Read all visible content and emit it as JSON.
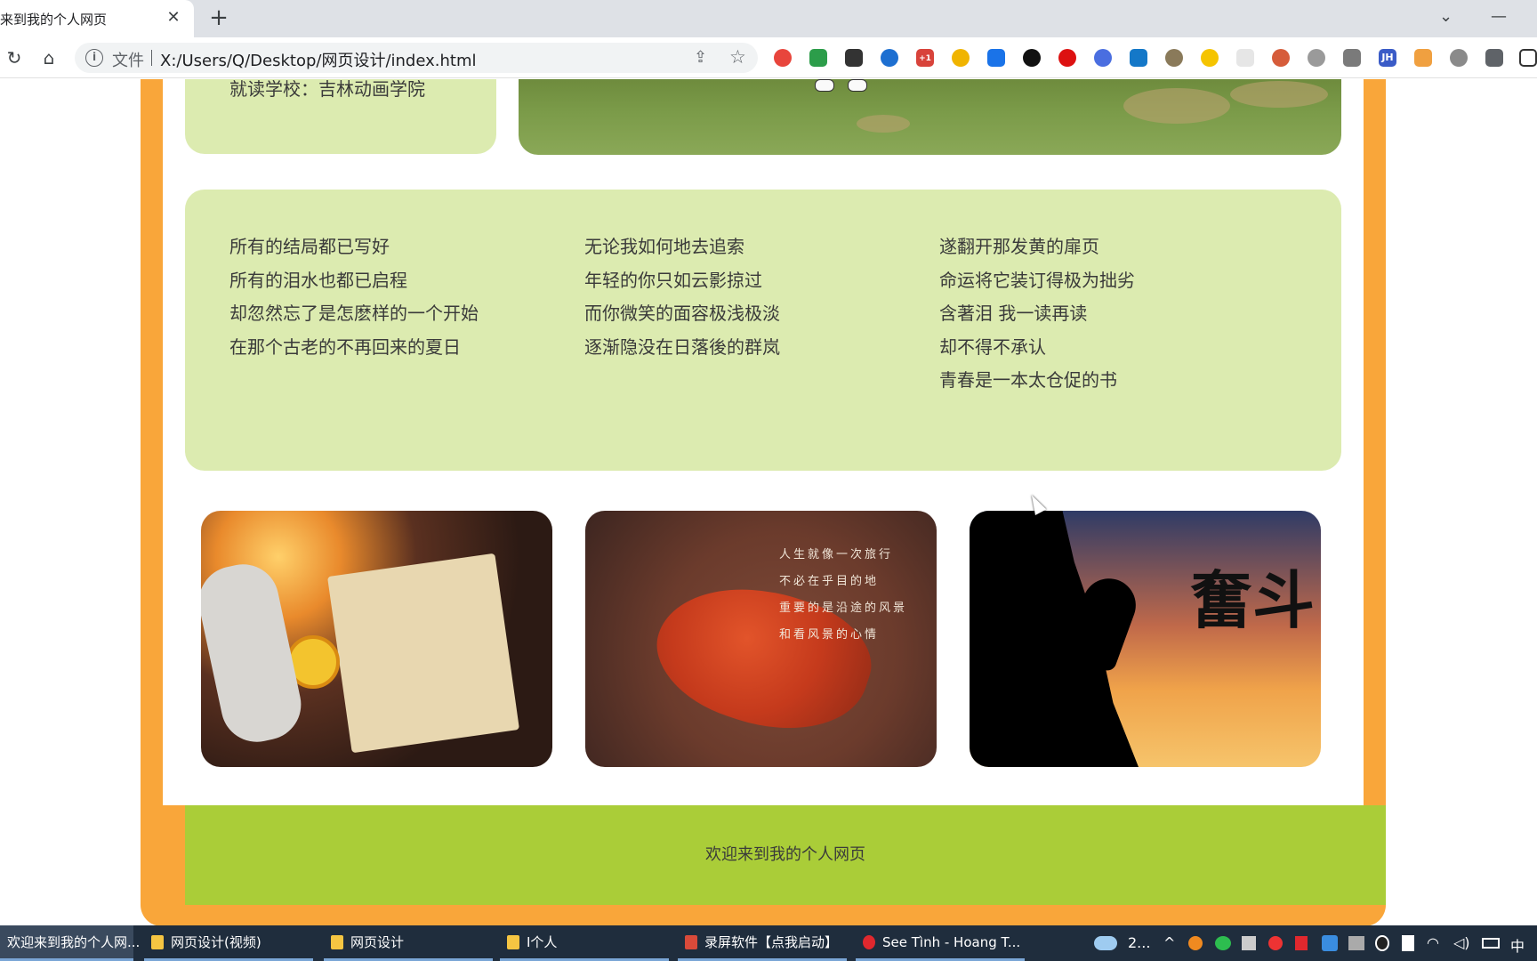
{
  "browser": {
    "tab_title": "来到我的个人网页",
    "tab_close": "✕",
    "new_tab": "+",
    "scheme_label": "文件",
    "url": "X:/Users/Q/Desktop/网页设计/index.html",
    "extensions": [
      "chrome-icon",
      "shield-icon",
      "terminal-icon",
      "search-icon",
      "calendar-icon",
      "chrome-icon",
      "download-icon",
      "openai-icon",
      "red-icon",
      "grammar-icon",
      "y-icon",
      "owl-icon",
      "smile-icon",
      "blank-icon",
      "tree-icon",
      "cloud-icon",
      "camera-icon",
      "jh-icon",
      "orange-icon",
      "gear-icon",
      "puzzle-icon",
      "sidebar-icon"
    ],
    "ext_badge": "+1",
    "ext_jh_label": "JH"
  },
  "page": {
    "info_text": "就读学校：吉林动画学院",
    "poem": {
      "col1": [
        "所有的结局都已写好",
        "所有的泪水也都已启程",
        "却忽然忘了是怎麽样的一个开始",
        "在那个古老的不再回来的夏日"
      ],
      "col2": [
        "无论我如何地去追索",
        "年轻的你只如云影掠过",
        "而你微笑的面容极浅极淡",
        "逐渐隐没在日落後的群岚"
      ],
      "col3": [
        "遂翻开那发黄的扉页",
        "命运将它装订得极为拙劣",
        "含著泪 我一读再读",
        "却不得不承认",
        "青春是一本太仓促的书"
      ]
    },
    "leaf_photo_text": [
      "人生就像一次旅行",
      "不必在乎目的地",
      "重要的是沿途的风景",
      "和看风景的心情"
    ],
    "climb_photo_title": "奮斗",
    "footer_text": "欢迎来到我的个人网页",
    "colors": {
      "frame": "#f9a63a",
      "card": "#dcebb0",
      "footer": "#aacd38"
    }
  },
  "taskbar": {
    "items": [
      "欢迎来到我的个人网...",
      "网页设计(视频)",
      "网页设计",
      "I个人",
      "录屏软件【点我启动】",
      "See Tình - Hoang T..."
    ],
    "weather": "2...",
    "ime": "中"
  }
}
